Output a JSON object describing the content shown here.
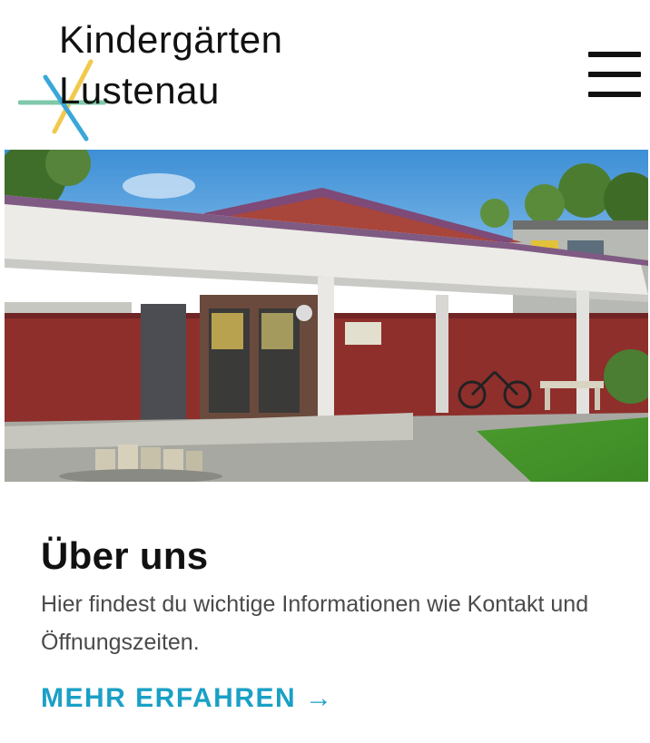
{
  "header": {
    "logo_line1": "Kindergärten",
    "logo_line2": "Lustenau",
    "menu_label": ""
  },
  "colors": {
    "accent": "#1aa0c6",
    "logo_yellow": "#f2c94c",
    "logo_green": "#7fc8a9",
    "logo_blue": "#3aa7d8"
  },
  "hero": {
    "image_desc": "kindergarten building photo"
  },
  "section": {
    "title": "Über uns",
    "description": "Hier findest du wichtige Informationen wie Kontakt und Öffnungszeiten.",
    "link_label": "MEHR ERFAHREN →"
  }
}
